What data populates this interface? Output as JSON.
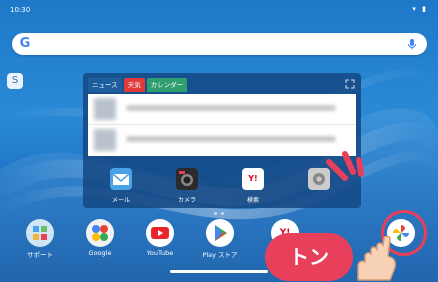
{
  "status_bar": {
    "time": "10:30",
    "icons": "▾ ▮"
  },
  "search": {
    "logo": "G"
  },
  "side_handle": {
    "label": "S"
  },
  "widget": {
    "tabs": [
      {
        "label": "ニュース"
      },
      {
        "label": "天気"
      },
      {
        "label": "カレンダー"
      }
    ],
    "apps": [
      {
        "label": "メール",
        "icon": "mail-icon"
      },
      {
        "label": "カメラ",
        "icon": "camera-icon"
      },
      {
        "label": "検索",
        "icon": "yahoo-search-icon",
        "mark": "Y!"
      },
      {
        "label": "",
        "icon": "gear-icon"
      }
    ]
  },
  "dock": [
    {
      "label": "サポート",
      "icon": "support-icon"
    },
    {
      "label": "Google",
      "icon": "google-icon"
    },
    {
      "label": "YouTube",
      "icon": "youtube-icon"
    },
    {
      "label": "Play ストア",
      "icon": "play-store-icon"
    },
    {
      "label": "Yahoo",
      "icon": "yahoo-icon",
      "mark": "Y!"
    },
    {
      "label": "",
      "icon": "google-photos-icon"
    }
  ],
  "callout": {
    "text": "トン"
  },
  "colors": {
    "accent": "#e8405a",
    "widget_bg": "#144682"
  }
}
